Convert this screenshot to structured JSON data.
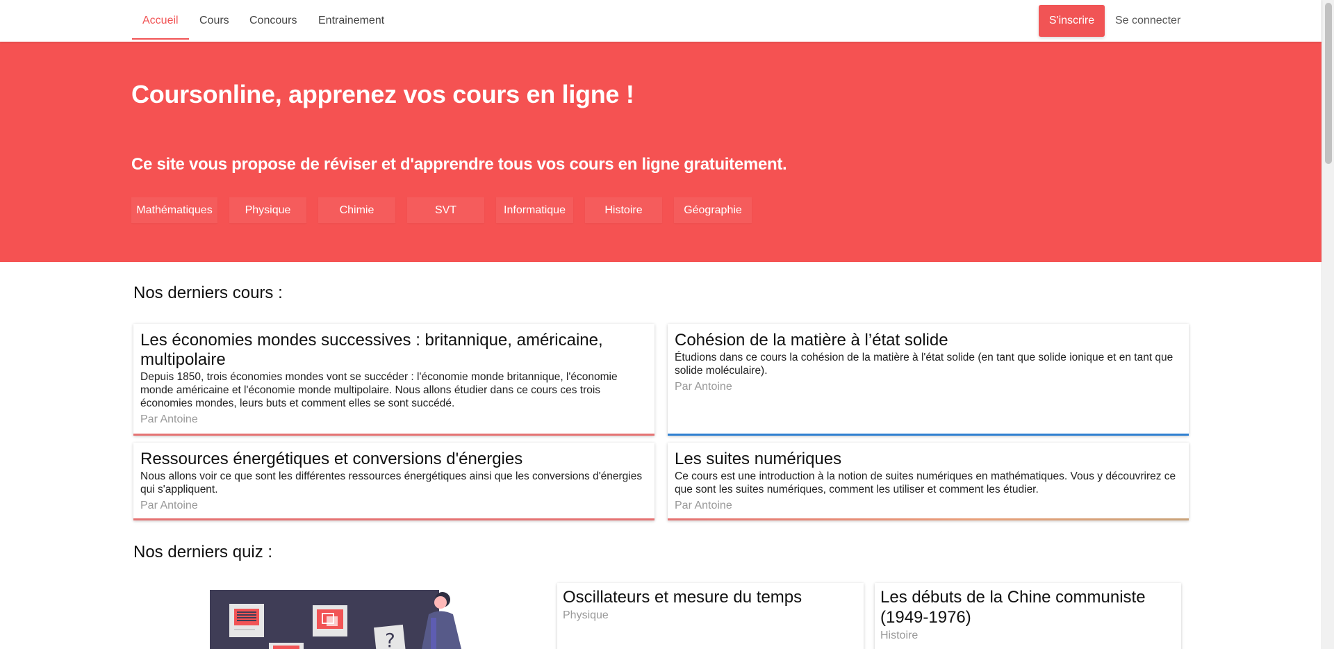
{
  "nav": {
    "items": [
      {
        "label": "Accueil",
        "active": true
      },
      {
        "label": "Cours",
        "active": false
      },
      {
        "label": "Concours",
        "active": false
      },
      {
        "label": "Entrainement",
        "active": false
      }
    ],
    "signup_label": "S'inscrire",
    "login_label": "Se connecter"
  },
  "hero": {
    "title": "Coursonline, apprenez vos cours en ligne !",
    "subtitle": "Ce site vous propose de réviser et d'apprendre tous vos cours en ligne gratuitement.",
    "subjects": [
      "Mathématiques",
      "Physique",
      "Chimie",
      "SVT",
      "Informatique",
      "Histoire",
      "Géographie"
    ]
  },
  "courses": {
    "heading": "Nos derniers cours :",
    "items": [
      {
        "title": "Les économies mondes successives : britannique, américaine, multipolaire",
        "description": "Depuis 1850, trois économies mondes vont se succéder : l'économie monde britannique, l'économie monde américaine et l'économie monde multipolaire. Nous allons étudier dans ce cours ces trois économies mondes, leurs buts et comment elles se sont succédé.",
        "author": "Par Antoine",
        "accent": "#e57373"
      },
      {
        "title": "Cohésion de la matière à l’état solide",
        "description": "Étudions dans ce cours la cohésion de la matière à l'état solide (en tant que solide ionique et en tant que solide moléculaire).",
        "author": "Par Antoine",
        "accent": "#2f80d1"
      },
      {
        "title": "Ressources énergétiques et conversions d'énergies",
        "description": "Nous allons voir ce que sont les différentes ressources énergétiques ainsi que les conversions d'énergies qui s'appliquent.",
        "author": "Par Antoine",
        "accent": "#e57373"
      },
      {
        "title": "Les suites numériques",
        "description": "Ce cours est une introduction à la notion de suites numériques en mathématiques. Vous y découvrirez ce que sont les suites numériques, comment les utiliser et comment les étudier.",
        "author": "Par Antoine",
        "accent": "#e8a07a"
      }
    ]
  },
  "quiz": {
    "heading": "Nos derniers quiz :",
    "items": [
      {
        "title": "Oscillateurs et mesure du temps",
        "subject": "Physique"
      },
      {
        "title": "Les débuts de la Chine communiste (1949-1976)",
        "subject": "Histoire"
      }
    ]
  },
  "colors": {
    "brand": "#f55252",
    "nav_active": "#f15455"
  },
  "icons": {
    "illustration": "question-board-illustration"
  }
}
